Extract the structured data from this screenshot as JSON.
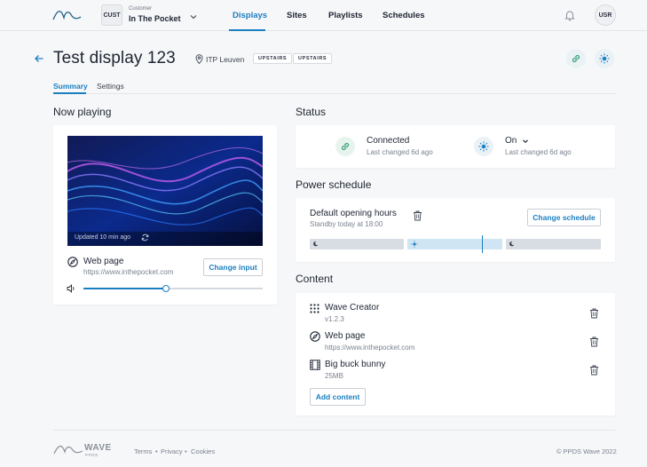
{
  "header": {
    "customer_badge": "CUST",
    "customer_label": "Customer",
    "customer_name": "In The Pocket",
    "nav": [
      "Displays",
      "Sites",
      "Playlists",
      "Schedules"
    ],
    "user_badge": "USR"
  },
  "display": {
    "title": "Test display 123",
    "location": "ITP Leuven",
    "tags": [
      "UPSTAIRS",
      "UPSTAIRS"
    ]
  },
  "tabs": [
    "Summary",
    "Settings"
  ],
  "now_playing": {
    "heading": "Now playing",
    "updated": "Updated 10 min ago",
    "input_name": "Web page",
    "input_url": "https://www.inthepocket.com",
    "change_input": "Change input",
    "volume_fraction": 0.46
  },
  "status": {
    "heading": "Status",
    "connection": "Connected",
    "connection_sub": "Last changed 6d ago",
    "power": "On",
    "power_sub": "Last changed 6d ago"
  },
  "power_schedule": {
    "heading": "Power schedule",
    "name": "Default opening hours",
    "sub": "Standby today at 18:00",
    "change": "Change schedule"
  },
  "content": {
    "heading": "Content",
    "items": [
      {
        "name": "Wave Creator",
        "sub": "v1.2.3",
        "icon": "grid-icon"
      },
      {
        "name": "Web page",
        "sub": "https://www.inthepocket.com",
        "icon": "compass-icon"
      },
      {
        "name": "Big buck bunny",
        "sub": "25MB",
        "icon": "film-icon"
      }
    ],
    "add": "Add content"
  },
  "footer": {
    "brand": "WAVE",
    "brand_sub": "PPDS",
    "links": [
      "Terms",
      "Privacy",
      "Cookies"
    ],
    "copyright": "© PPDS Wave 2022"
  },
  "colors": {
    "accent": "#1a7fc1",
    "connected_green": "#2f9e6e"
  }
}
